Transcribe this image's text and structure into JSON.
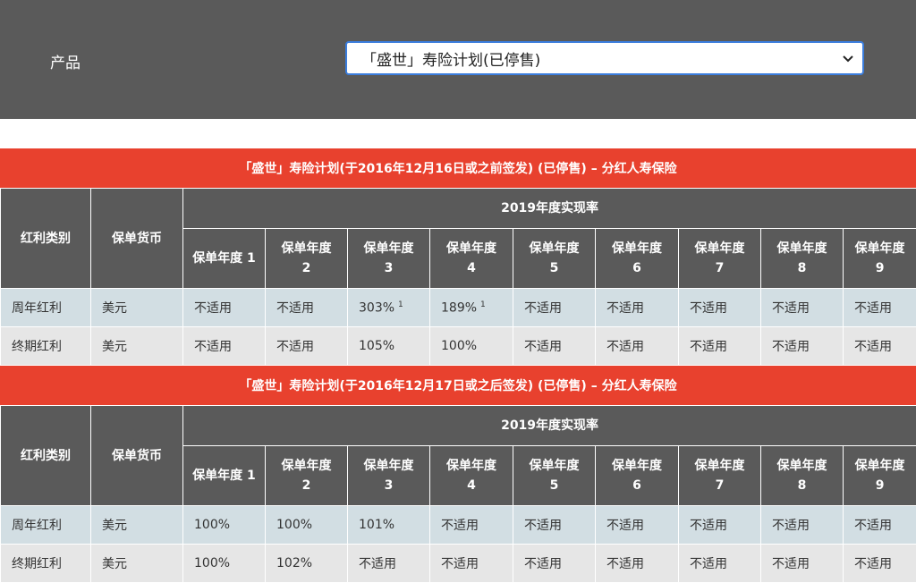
{
  "header": {
    "product_label": "产品",
    "product_select_value": "「盛世」寿险计划(已停售)"
  },
  "sections": [
    {
      "title": "「盛世」寿险计划(于2016年12月16日或之前签发) (已停售) – 分红人寿保险",
      "col_dividend": "红利类别",
      "col_currency": "保单货币",
      "rate_header": "2019年度实现率",
      "years": [
        "保单年度 1",
        "保单年度\n2",
        "保单年度\n3",
        "保单年度\n4",
        "保单年度\n5",
        "保单年度\n6",
        "保单年度\n7",
        "保单年度\n8",
        "保单年度\n9"
      ],
      "rows": [
        {
          "type": "周年红利",
          "currency": "美元",
          "values": [
            {
              "v": "不适用"
            },
            {
              "v": "不适用"
            },
            {
              "v": "303%",
              "note": "1"
            },
            {
              "v": "189%",
              "note": "1"
            },
            {
              "v": "不适用"
            },
            {
              "v": "不适用"
            },
            {
              "v": "不适用"
            },
            {
              "v": "不适用"
            },
            {
              "v": "不适用"
            }
          ]
        },
        {
          "type": "终期红利",
          "currency": "美元",
          "values": [
            {
              "v": "不适用"
            },
            {
              "v": "不适用"
            },
            {
              "v": "105%"
            },
            {
              "v": "100%"
            },
            {
              "v": "不适用"
            },
            {
              "v": "不适用"
            },
            {
              "v": "不适用"
            },
            {
              "v": "不适用"
            },
            {
              "v": "不适用"
            }
          ]
        }
      ]
    },
    {
      "title": "「盛世」寿险计划(于2016年12月17日或之后签发) (已停售) – 分红人寿保险",
      "col_dividend": "红利类别",
      "col_currency": "保单货币",
      "rate_header": "2019年度实现率",
      "years": [
        "保单年度 1",
        "保单年度\n2",
        "保单年度\n3",
        "保单年度\n4",
        "保单年度\n5",
        "保单年度\n6",
        "保单年度\n7",
        "保单年度\n8",
        "保单年度\n9"
      ],
      "rows": [
        {
          "type": "周年红利",
          "currency": "美元",
          "values": [
            {
              "v": "100%"
            },
            {
              "v": "100%"
            },
            {
              "v": "101%"
            },
            {
              "v": "不适用"
            },
            {
              "v": "不适用"
            },
            {
              "v": "不适用"
            },
            {
              "v": "不适用"
            },
            {
              "v": "不适用"
            },
            {
              "v": "不适用"
            }
          ]
        },
        {
          "type": "终期红利",
          "currency": "美元",
          "values": [
            {
              "v": "100%"
            },
            {
              "v": "102%"
            },
            {
              "v": "不适用"
            },
            {
              "v": "不适用"
            },
            {
              "v": "不适用"
            },
            {
              "v": "不适用"
            },
            {
              "v": "不适用"
            },
            {
              "v": "不适用"
            },
            {
              "v": "不适用"
            }
          ]
        }
      ]
    }
  ]
}
